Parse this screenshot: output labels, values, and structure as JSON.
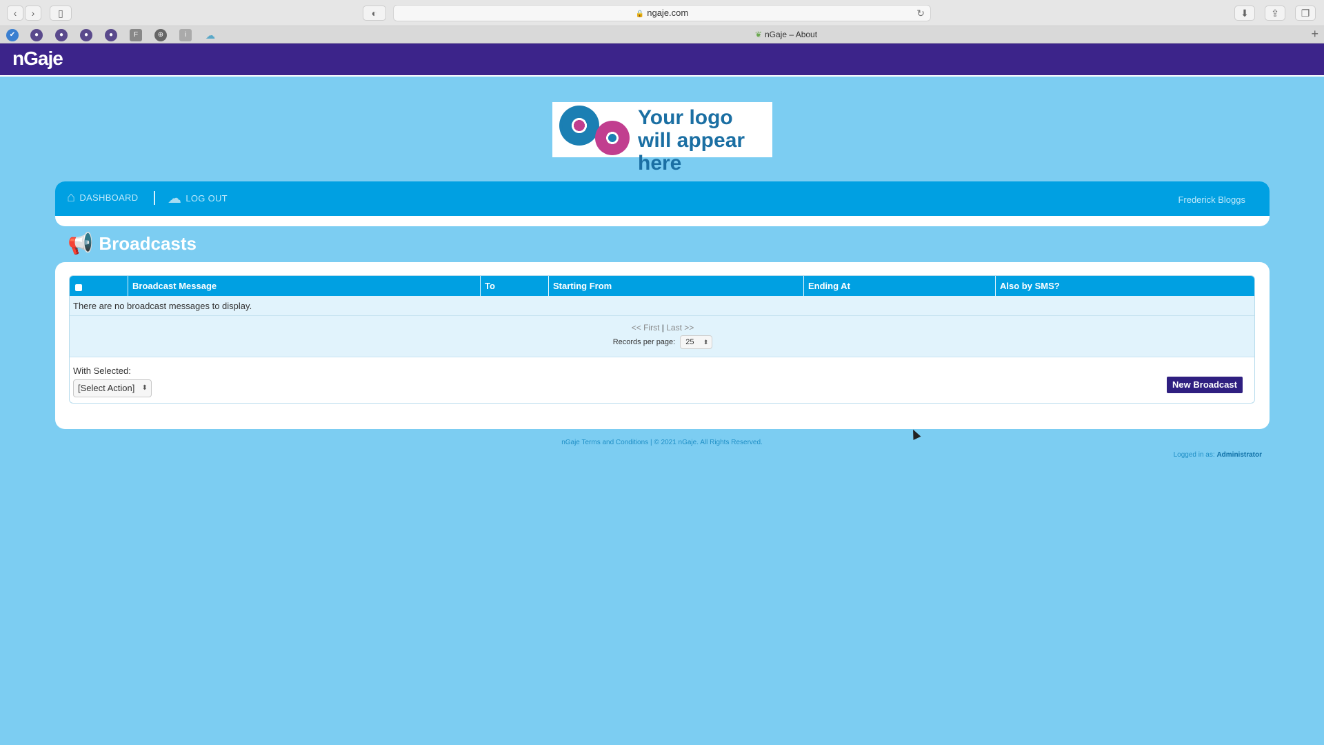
{
  "browser": {
    "url": "ngaje.com",
    "tab_title": "nGaje – About",
    "favicons": [
      "app-icon-1",
      "app-icon-2",
      "app-icon-3",
      "app-icon-4",
      "app-icon-5",
      "F",
      "globe",
      "i",
      "cloud"
    ]
  },
  "app": {
    "brand": "nGaje",
    "logo_text": "Your logo will appear here",
    "nav": {
      "dashboard": "DASHBOARD",
      "logout": "LOG OUT",
      "user": "Frederick Bloggs"
    },
    "page_title": "Broadcasts",
    "table": {
      "columns": [
        "Broadcast Message",
        "To",
        "Starting From",
        "Ending At",
        "Also by SMS?"
      ],
      "empty_message": "There are no broadcast messages to display."
    },
    "pagination": {
      "first": "<< First",
      "separator": "|",
      "last": "Last >>",
      "records_label": "Records per page:",
      "records_value": "25"
    },
    "with_selected_label": "With Selected:",
    "action_select": "[Select Action]",
    "new_button": "New Broadcast",
    "footer": {
      "terms": "nGaje Terms and Conditions",
      "divider": "|",
      "copyright": "© 2021 nGaje. All Rights Reserved.",
      "logged_in_label": "Logged in as:",
      "logged_in_user": "Administrator"
    }
  },
  "colors": {
    "background": "#7ccdf2",
    "header": "#3c248a",
    "nav": "#00a0e2",
    "button": "#2f1f80"
  }
}
